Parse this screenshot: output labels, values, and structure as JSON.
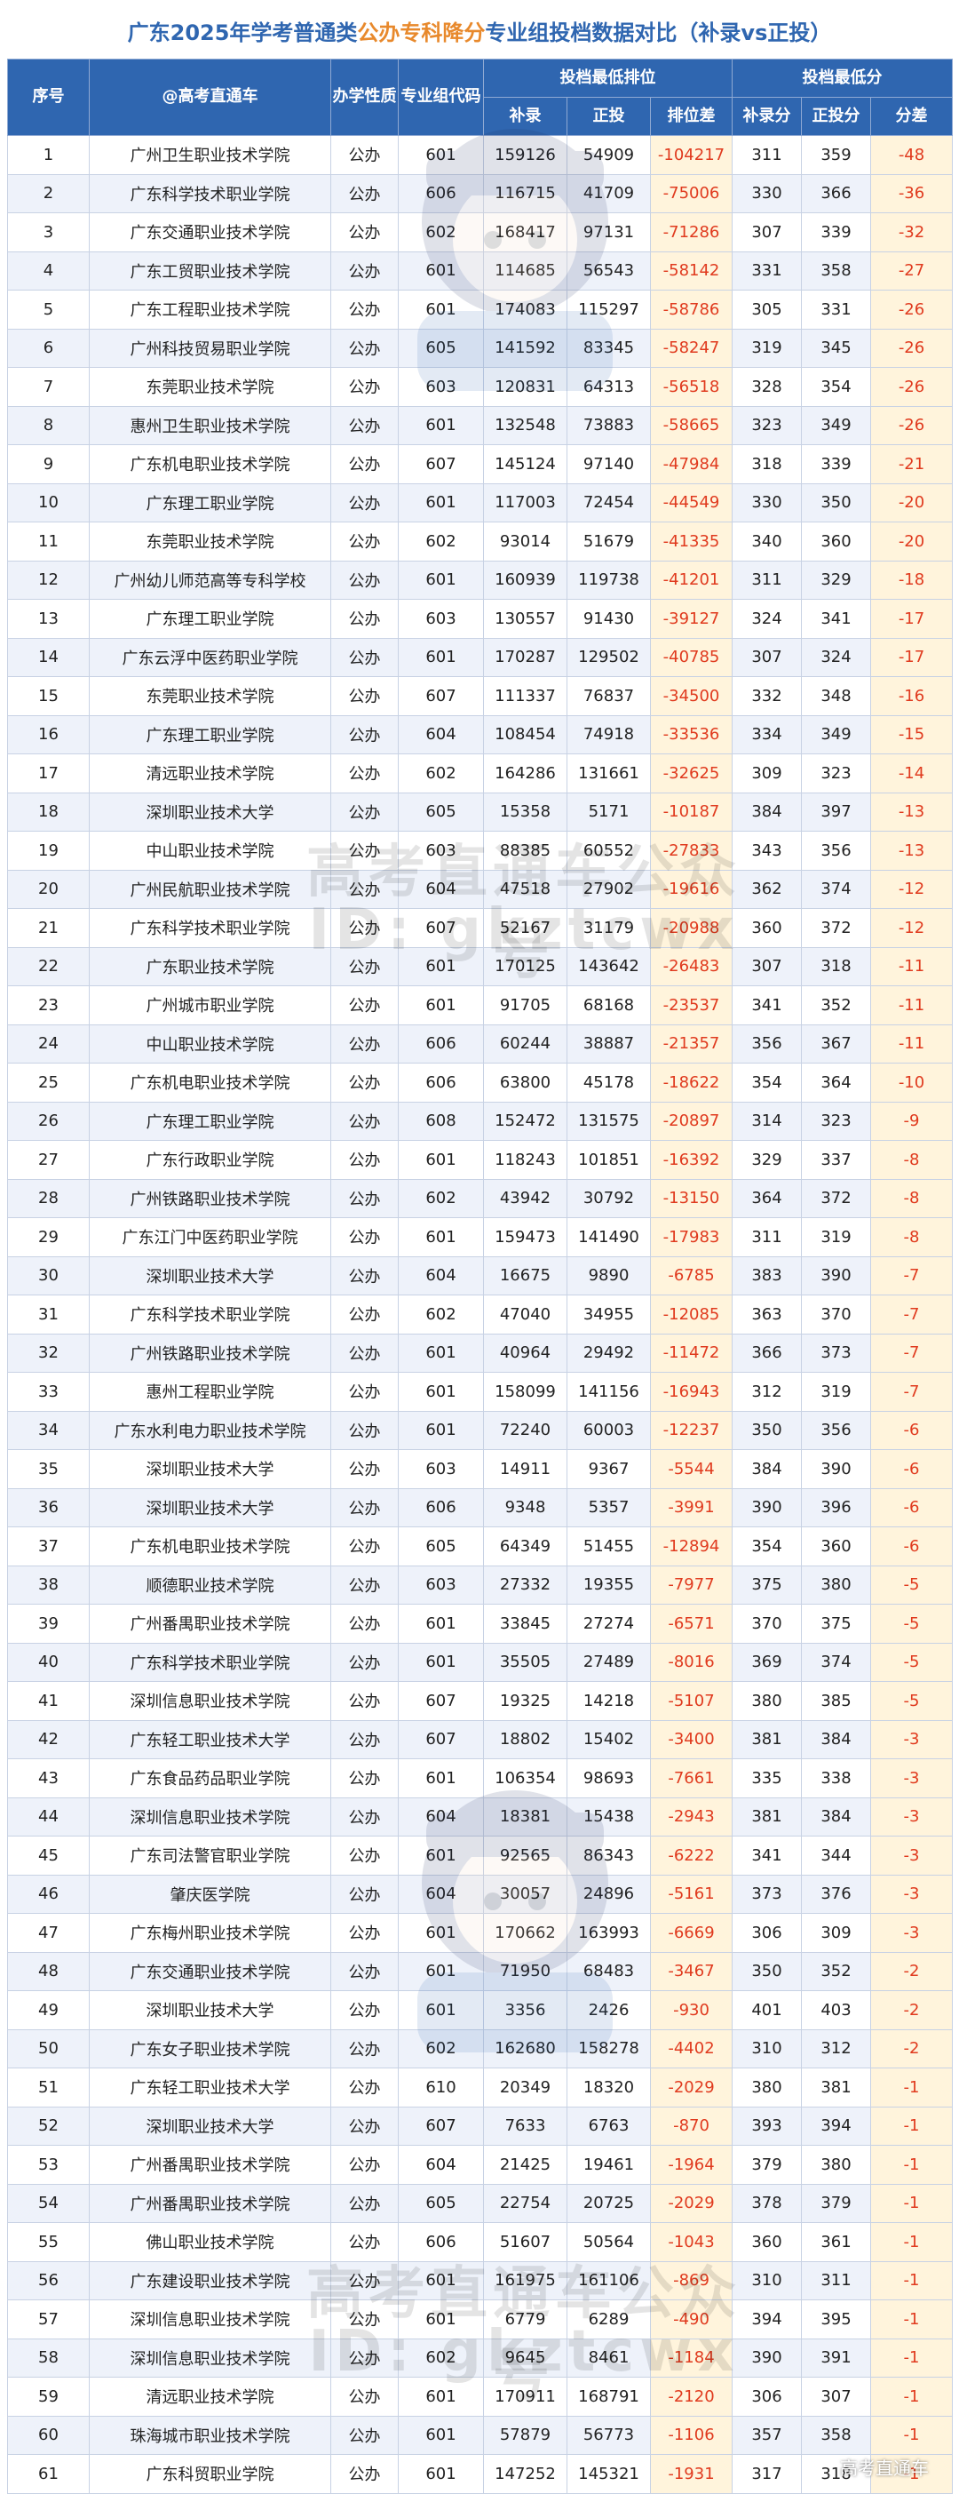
{
  "title": {
    "prefix": "广东2025年学考普通类",
    "accent": "公办专科降分",
    "suffix": "专业组投档数据对比（补录vs正投）"
  },
  "header": {
    "seq": "序号",
    "school": "@高考直通车",
    "nature": "办学性质",
    "group_code": "专业组代码",
    "rank_group": "投档最低排位",
    "score_group": "投档最低分",
    "supp": "补录",
    "regular": "正投",
    "rank_diff": "排位差",
    "supp_score": "补录分",
    "regular_score": "正投分",
    "score_diff": "分差"
  },
  "watermark": {
    "line1": "高考直通车公众号",
    "line2": "ID: gkztcwx"
  },
  "corner_mark": "高考直通车",
  "rows": [
    [
      "1",
      "广州卫生职业技术学院",
      "公办",
      "601",
      "159126",
      "54909",
      "-104217",
      "311",
      "359",
      "-48"
    ],
    [
      "2",
      "广东科学技术职业学院",
      "公办",
      "606",
      "116715",
      "41709",
      "-75006",
      "330",
      "366",
      "-36"
    ],
    [
      "3",
      "广东交通职业技术学院",
      "公办",
      "602",
      "168417",
      "97131",
      "-71286",
      "307",
      "339",
      "-32"
    ],
    [
      "4",
      "广东工贸职业技术学院",
      "公办",
      "601",
      "114685",
      "56543",
      "-58142",
      "331",
      "358",
      "-27"
    ],
    [
      "5",
      "广东工程职业技术学院",
      "公办",
      "601",
      "174083",
      "115297",
      "-58786",
      "305",
      "331",
      "-26"
    ],
    [
      "6",
      "广州科技贸易职业学院",
      "公办",
      "605",
      "141592",
      "83345",
      "-58247",
      "319",
      "345",
      "-26"
    ],
    [
      "7",
      "东莞职业技术学院",
      "公办",
      "603",
      "120831",
      "64313",
      "-56518",
      "328",
      "354",
      "-26"
    ],
    [
      "8",
      "惠州卫生职业技术学院",
      "公办",
      "601",
      "132548",
      "73883",
      "-58665",
      "323",
      "349",
      "-26"
    ],
    [
      "9",
      "广东机电职业技术学院",
      "公办",
      "607",
      "145124",
      "97140",
      "-47984",
      "318",
      "339",
      "-21"
    ],
    [
      "10",
      "广东理工职业学院",
      "公办",
      "601",
      "117003",
      "72454",
      "-44549",
      "330",
      "350",
      "-20"
    ],
    [
      "11",
      "东莞职业技术学院",
      "公办",
      "602",
      "93014",
      "51679",
      "-41335",
      "340",
      "360",
      "-20"
    ],
    [
      "12",
      "广州幼儿师范高等专科学校",
      "公办",
      "601",
      "160939",
      "119738",
      "-41201",
      "311",
      "329",
      "-18"
    ],
    [
      "13",
      "广东理工职业学院",
      "公办",
      "603",
      "130557",
      "91430",
      "-39127",
      "324",
      "341",
      "-17"
    ],
    [
      "14",
      "广东云浮中医药职业学院",
      "公办",
      "601",
      "170287",
      "129502",
      "-40785",
      "307",
      "324",
      "-17"
    ],
    [
      "15",
      "东莞职业技术学院",
      "公办",
      "607",
      "111337",
      "76837",
      "-34500",
      "332",
      "348",
      "-16"
    ],
    [
      "16",
      "广东理工职业学院",
      "公办",
      "604",
      "108454",
      "74918",
      "-33536",
      "334",
      "349",
      "-15"
    ],
    [
      "17",
      "清远职业技术学院",
      "公办",
      "602",
      "164286",
      "131661",
      "-32625",
      "309",
      "323",
      "-14"
    ],
    [
      "18",
      "深圳职业技术大学",
      "公办",
      "605",
      "15358",
      "5171",
      "-10187",
      "384",
      "397",
      "-13"
    ],
    [
      "19",
      "中山职业技术学院",
      "公办",
      "603",
      "88385",
      "60552",
      "-27833",
      "343",
      "356",
      "-13"
    ],
    [
      "20",
      "广州民航职业技术学院",
      "公办",
      "604",
      "47518",
      "27902",
      "-19616",
      "362",
      "374",
      "-12"
    ],
    [
      "21",
      "广东科学技术职业学院",
      "公办",
      "607",
      "52167",
      "31179",
      "-20988",
      "360",
      "372",
      "-12"
    ],
    [
      "22",
      "广东职业技术学院",
      "公办",
      "601",
      "170125",
      "143642",
      "-26483",
      "307",
      "318",
      "-11"
    ],
    [
      "23",
      "广州城市职业学院",
      "公办",
      "601",
      "91705",
      "68168",
      "-23537",
      "341",
      "352",
      "-11"
    ],
    [
      "24",
      "中山职业技术学院",
      "公办",
      "606",
      "60244",
      "38887",
      "-21357",
      "356",
      "367",
      "-11"
    ],
    [
      "25",
      "广东机电职业技术学院",
      "公办",
      "606",
      "63800",
      "45178",
      "-18622",
      "354",
      "364",
      "-10"
    ],
    [
      "26",
      "广东理工职业学院",
      "公办",
      "608",
      "152472",
      "131575",
      "-20897",
      "314",
      "323",
      "-9"
    ],
    [
      "27",
      "广东行政职业学院",
      "公办",
      "601",
      "118243",
      "101851",
      "-16392",
      "329",
      "337",
      "-8"
    ],
    [
      "28",
      "广州铁路职业技术学院",
      "公办",
      "602",
      "43942",
      "30792",
      "-13150",
      "364",
      "372",
      "-8"
    ],
    [
      "29",
      "广东江门中医药职业学院",
      "公办",
      "601",
      "159473",
      "141490",
      "-17983",
      "311",
      "319",
      "-8"
    ],
    [
      "30",
      "深圳职业技术大学",
      "公办",
      "604",
      "16675",
      "9890",
      "-6785",
      "383",
      "390",
      "-7"
    ],
    [
      "31",
      "广东科学技术职业学院",
      "公办",
      "602",
      "47040",
      "34955",
      "-12085",
      "363",
      "370",
      "-7"
    ],
    [
      "32",
      "广州铁路职业技术学院",
      "公办",
      "601",
      "40964",
      "29492",
      "-11472",
      "366",
      "373",
      "-7"
    ],
    [
      "33",
      "惠州工程职业学院",
      "公办",
      "601",
      "158099",
      "141156",
      "-16943",
      "312",
      "319",
      "-7"
    ],
    [
      "34",
      "广东水利电力职业技术学院",
      "公办",
      "601",
      "72240",
      "60003",
      "-12237",
      "350",
      "356",
      "-6"
    ],
    [
      "35",
      "深圳职业技术大学",
      "公办",
      "603",
      "14911",
      "9367",
      "-5544",
      "384",
      "390",
      "-6"
    ],
    [
      "36",
      "深圳职业技术大学",
      "公办",
      "606",
      "9348",
      "5357",
      "-3991",
      "390",
      "396",
      "-6"
    ],
    [
      "37",
      "广东机电职业技术学院",
      "公办",
      "605",
      "64349",
      "51455",
      "-12894",
      "354",
      "360",
      "-6"
    ],
    [
      "38",
      "顺德职业技术学院",
      "公办",
      "603",
      "27332",
      "19355",
      "-7977",
      "375",
      "380",
      "-5"
    ],
    [
      "39",
      "广州番禺职业技术学院",
      "公办",
      "601",
      "33845",
      "27274",
      "-6571",
      "370",
      "375",
      "-5"
    ],
    [
      "40",
      "广东科学技术职业学院",
      "公办",
      "601",
      "35505",
      "27489",
      "-8016",
      "369",
      "374",
      "-5"
    ],
    [
      "41",
      "深圳信息职业技术学院",
      "公办",
      "607",
      "19325",
      "14218",
      "-5107",
      "380",
      "385",
      "-5"
    ],
    [
      "42",
      "广东轻工职业技术大学",
      "公办",
      "607",
      "18802",
      "15402",
      "-3400",
      "381",
      "384",
      "-3"
    ],
    [
      "43",
      "广东食品药品职业学院",
      "公办",
      "601",
      "106354",
      "98693",
      "-7661",
      "335",
      "338",
      "-3"
    ],
    [
      "44",
      "深圳信息职业技术学院",
      "公办",
      "604",
      "18381",
      "15438",
      "-2943",
      "381",
      "384",
      "-3"
    ],
    [
      "45",
      "广东司法警官职业学院",
      "公办",
      "601",
      "92565",
      "86343",
      "-6222",
      "341",
      "344",
      "-3"
    ],
    [
      "46",
      "肇庆医学院",
      "公办",
      "604",
      "30057",
      "24896",
      "-5161",
      "373",
      "376",
      "-3"
    ],
    [
      "47",
      "广东梅州职业技术学院",
      "公办",
      "601",
      "170662",
      "163993",
      "-6669",
      "306",
      "309",
      "-3"
    ],
    [
      "48",
      "广东交通职业技术学院",
      "公办",
      "601",
      "71950",
      "68483",
      "-3467",
      "350",
      "352",
      "-2"
    ],
    [
      "49",
      "深圳职业技术大学",
      "公办",
      "601",
      "3356",
      "2426",
      "-930",
      "401",
      "403",
      "-2"
    ],
    [
      "50",
      "广东女子职业技术学院",
      "公办",
      "602",
      "162680",
      "158278",
      "-4402",
      "310",
      "312",
      "-2"
    ],
    [
      "51",
      "广东轻工职业技术大学",
      "公办",
      "610",
      "20349",
      "18320",
      "-2029",
      "380",
      "381",
      "-1"
    ],
    [
      "52",
      "深圳职业技术大学",
      "公办",
      "607",
      "7633",
      "6763",
      "-870",
      "393",
      "394",
      "-1"
    ],
    [
      "53",
      "广州番禺职业技术学院",
      "公办",
      "604",
      "21425",
      "19461",
      "-1964",
      "379",
      "380",
      "-1"
    ],
    [
      "54",
      "广州番禺职业技术学院",
      "公办",
      "605",
      "22754",
      "20725",
      "-2029",
      "378",
      "379",
      "-1"
    ],
    [
      "55",
      "佛山职业技术学院",
      "公办",
      "606",
      "51607",
      "50564",
      "-1043",
      "360",
      "361",
      "-1"
    ],
    [
      "56",
      "广东建设职业技术学院",
      "公办",
      "601",
      "161975",
      "161106",
      "-869",
      "310",
      "311",
      "-1"
    ],
    [
      "57",
      "深圳信息职业技术学院",
      "公办",
      "601",
      "6779",
      "6289",
      "-490",
      "394",
      "395",
      "-1"
    ],
    [
      "58",
      "深圳信息职业技术学院",
      "公办",
      "602",
      "9645",
      "8461",
      "-1184",
      "390",
      "391",
      "-1"
    ],
    [
      "59",
      "清远职业技术学院",
      "公办",
      "601",
      "170911",
      "168791",
      "-2120",
      "306",
      "307",
      "-1"
    ],
    [
      "60",
      "珠海城市职业技术学院",
      "公办",
      "601",
      "57879",
      "56773",
      "-1106",
      "357",
      "358",
      "-1"
    ],
    [
      "61",
      "广东科贸职业学院",
      "公办",
      "601",
      "147252",
      "145321",
      "-1931",
      "317",
      "318",
      "-1"
    ]
  ]
}
